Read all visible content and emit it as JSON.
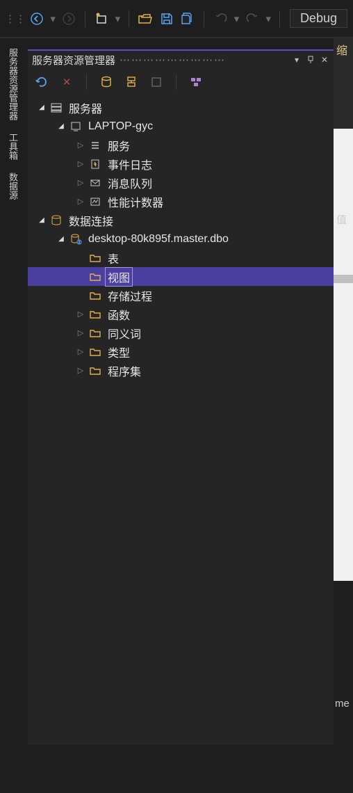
{
  "toolbar": {
    "debug_label": "Debug"
  },
  "sidetabs": {
    "server_explorer": "服务器资源管理器",
    "toolbox": "工具箱",
    "datasource": "数据源"
  },
  "panel": {
    "title": "服务器资源管理器"
  },
  "tree": {
    "servers": {
      "label": "服务器",
      "machine": "LAPTOP-gyc",
      "services": "服务",
      "eventlog": "事件日志",
      "mqueue": "消息队列",
      "perfcounter": "性能计数器"
    },
    "dataconn": {
      "label": "数据连接",
      "db": "desktop-80k895f.master.dbo",
      "tables": "表",
      "views": "视图",
      "sprocs": "存储过程",
      "functions": "函数",
      "synonyms": "同义词",
      "types": "类型",
      "assemblies": "程序集"
    }
  },
  "right": {
    "top": "缩",
    "mid": "值",
    "bottom": "me"
  }
}
